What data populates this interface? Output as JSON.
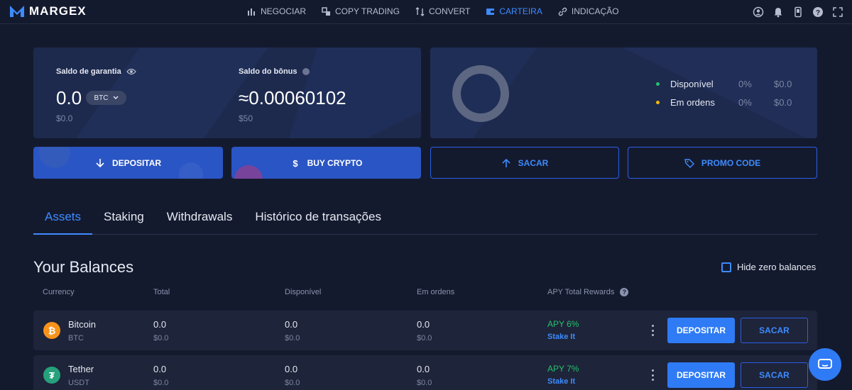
{
  "brand": {
    "name": "MARGEX",
    "accent": "#3d8bff",
    "card_bg": "#1d2a4e",
    "page_bg": "#141a2e",
    "positive": "#25c26e"
  },
  "nav": [
    {
      "label": "NEGOCIAR",
      "icon": "bar-chart-icon"
    },
    {
      "label": "COPY TRADING",
      "icon": "copy-trading-icon"
    },
    {
      "label": "CONVERT",
      "icon": "convert-arrows-icon"
    },
    {
      "label": "CARTEIRA",
      "icon": "wallet-icon",
      "active": true
    },
    {
      "label": "INDICAÇÃO",
      "icon": "link-icon"
    }
  ],
  "top_icons": [
    "user-icon",
    "bell-icon",
    "phone-icon",
    "help-icon",
    "expand-icon"
  ],
  "balance": {
    "collateral_label": "Saldo de garantia",
    "collateral_value": "0.0",
    "collateral_coin": "BTC",
    "collateral_usd": "$0.0",
    "bonus_label": "Saldo do bônus",
    "bonus_value": "≈0.00060102",
    "bonus_usd": "$50"
  },
  "distribution": [
    {
      "label": "Disponível",
      "pct": "0%",
      "amount": "$0.0",
      "color": "#25c26e"
    },
    {
      "label": "Em ordens",
      "pct": "0%",
      "amount": "$0.0",
      "color": "#f0b90b"
    }
  ],
  "actions": {
    "deposit": "DEPOSITAR",
    "buy": "BUY CRYPTO",
    "withdraw": "SACAR",
    "promo": "PROMO CODE"
  },
  "tabs": [
    "Assets",
    "Staking",
    "Withdrawals",
    "Histórico de transações"
  ],
  "balances": {
    "title": "Your Balances",
    "hide_zero": "Hide zero balances",
    "columns": [
      "Currency",
      "Total",
      "Disponível",
      "Em ordens",
      "APY Total Rewards"
    ],
    "rows": [
      {
        "name": "Bitcoin",
        "ticker": "BTC",
        "total": "0.0",
        "total_usd": "$0.0",
        "avail": "0.0",
        "avail_usd": "$0.0",
        "orders": "0.0",
        "orders_usd": "$0.0",
        "apy": "APY 6%",
        "stake": "Stake It",
        "icon_color": "#f7931a",
        "deposit": "DEPOSITAR",
        "withdraw": "SACAR"
      },
      {
        "name": "Tether",
        "ticker": "USDT",
        "total": "0.0",
        "total_usd": "$0.0",
        "avail": "0.0",
        "avail_usd": "$0.0",
        "orders": "0.0",
        "orders_usd": "$0.0",
        "apy": "APY 7%",
        "stake": "Stake It",
        "icon_color": "#26a17b",
        "deposit": "DEPOSITAR",
        "withdraw": "SACAR"
      }
    ]
  }
}
